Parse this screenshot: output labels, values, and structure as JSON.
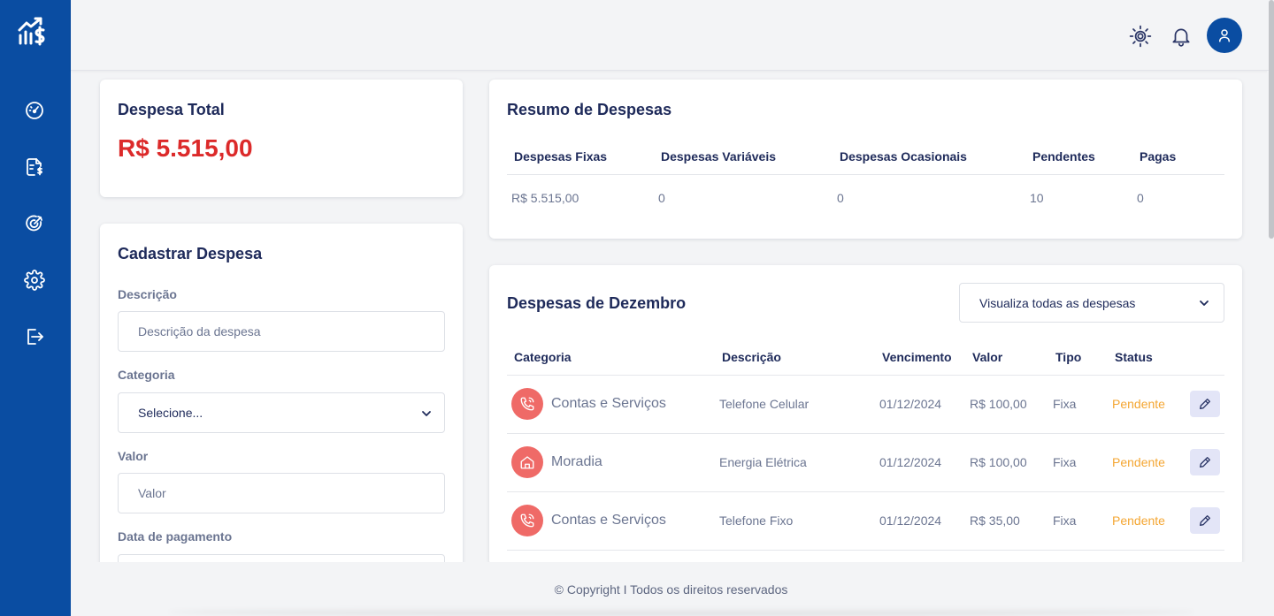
{
  "sidebar": {
    "logo_icon": "chart-dollar-logo",
    "items": [
      {
        "icon": "dashboard-gauge-icon"
      },
      {
        "icon": "expenses-document-icon"
      },
      {
        "icon": "goals-target-icon"
      },
      {
        "icon": "settings-gear-icon"
      },
      {
        "icon": "logout-icon"
      }
    ],
    "color": "#0a4da2"
  },
  "header": {
    "theme_icon": "sun-icon",
    "notification_icon": "bell-icon",
    "avatar_icon": "user-icon"
  },
  "total": {
    "title": "Despesa Total",
    "value": "R$ 5.515,00",
    "value_color": "#dc2a2a"
  },
  "form": {
    "title": "Cadastrar Despesa",
    "descricao_label": "Descrição",
    "descricao_placeholder": "Descrição da despesa",
    "categoria_label": "Categoria",
    "categoria_value": "Selecione...",
    "valor_label": "Valor",
    "valor_placeholder": "Valor",
    "data_label": "Data de pagamento"
  },
  "summary": {
    "title": "Resumo de Despesas",
    "headers": [
      "Despesas Fixas",
      "Despesas Variáveis",
      "Despesas Ocasionais",
      "Pendentes",
      "Pagas"
    ],
    "values": [
      "R$ 5.515,00",
      "0",
      "0",
      "10",
      "0"
    ]
  },
  "monthly": {
    "title": "Despesas de Dezembro",
    "filter_value": "Visualiza todas as despesas",
    "headers": [
      "Categoria",
      "Descrição",
      "Vencimento",
      "Valor",
      "Tipo",
      "Status"
    ],
    "rows": [
      {
        "icon": "phone-icon",
        "categoria": "Contas e Serviços",
        "descricao": "Telefone Celular",
        "vencimento": "01/12/2024",
        "valor": "R$ 100,00",
        "tipo": "Fixa",
        "status": "Pendente"
      },
      {
        "icon": "home-icon",
        "categoria": "Moradia",
        "descricao": "Energia Elétrica",
        "vencimento": "01/12/2024",
        "valor": "R$ 100,00",
        "tipo": "Fixa",
        "status": "Pendente"
      },
      {
        "icon": "phone-icon",
        "categoria": "Contas e Serviços",
        "descricao": "Telefone Fixo",
        "vencimento": "01/12/2024",
        "valor": "R$ 35,00",
        "tipo": "Fixa",
        "status": "Pendente"
      }
    ],
    "status_color": "#f4a632",
    "category_icon_color": "#ef6a67"
  },
  "footer": {
    "text": "© Copyright I Todos os direitos reservados"
  }
}
